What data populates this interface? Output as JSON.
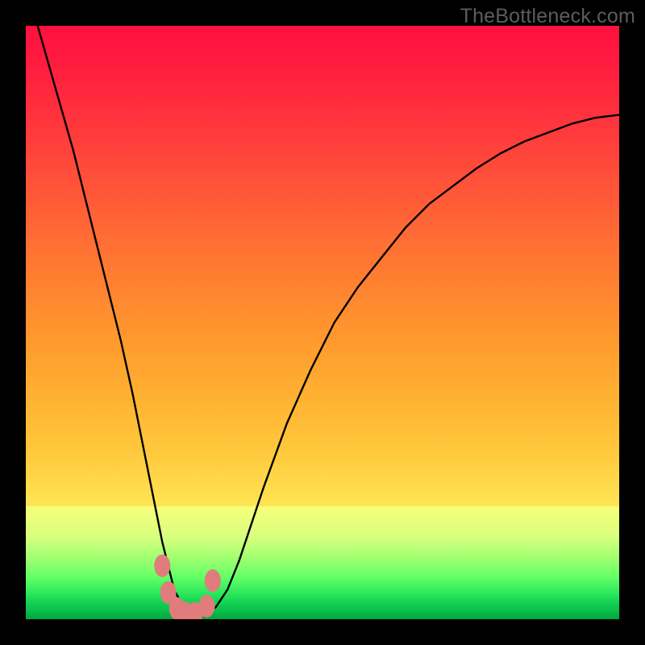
{
  "watermark": "TheBottleneck.com",
  "chart_data": {
    "type": "line",
    "title": "",
    "xlabel": "",
    "ylabel": "",
    "xlim": [
      0,
      100
    ],
    "ylim": [
      0,
      100
    ],
    "x": [
      0,
      2,
      4,
      6,
      8,
      10,
      12,
      14,
      16,
      18,
      20,
      21,
      22,
      23,
      24,
      25,
      26,
      27,
      28,
      29,
      30,
      32,
      34,
      36,
      38,
      40,
      44,
      48,
      52,
      56,
      60,
      64,
      68,
      72,
      76,
      80,
      84,
      88,
      92,
      96,
      100
    ],
    "values": [
      106,
      100,
      93,
      86,
      79,
      71,
      63,
      55,
      47,
      38,
      28,
      23,
      18,
      13,
      9,
      5,
      3,
      1.5,
      1,
      1,
      1,
      2,
      5,
      10,
      16,
      22,
      33,
      42,
      50,
      56,
      61,
      66,
      70,
      73,
      76,
      78.5,
      80.5,
      82,
      83.5,
      84.5,
      85
    ],
    "grid": false,
    "legend": false,
    "annotations": [
      {
        "text": "TheBottleneck.com",
        "position": "top-right"
      }
    ],
    "markers": {
      "color": "#e07c7c",
      "points_x": [
        23.0,
        24.0,
        25.5,
        27.0,
        28.5,
        30.5,
        31.5
      ],
      "points_y": [
        9.0,
        4.5,
        1.8,
        1.0,
        1.0,
        2.2,
        6.5
      ]
    },
    "gradient_stops": {
      "description": "vertical gradient behind curve, value encoded by color (red=high mismatch, green=optimal)",
      "stops": [
        {
          "pos": 0.0,
          "color": "#ff103f"
        },
        {
          "pos": 0.3,
          "color": "#ff5c37"
        },
        {
          "pos": 0.6,
          "color": "#ffab30"
        },
        {
          "pos": 0.8,
          "color": "#ffe252"
        },
        {
          "pos": 0.86,
          "color": "#d9ff7d"
        },
        {
          "pos": 0.93,
          "color": "#61ff66"
        },
        {
          "pos": 1.0,
          "color": "#02a844"
        }
      ]
    }
  }
}
